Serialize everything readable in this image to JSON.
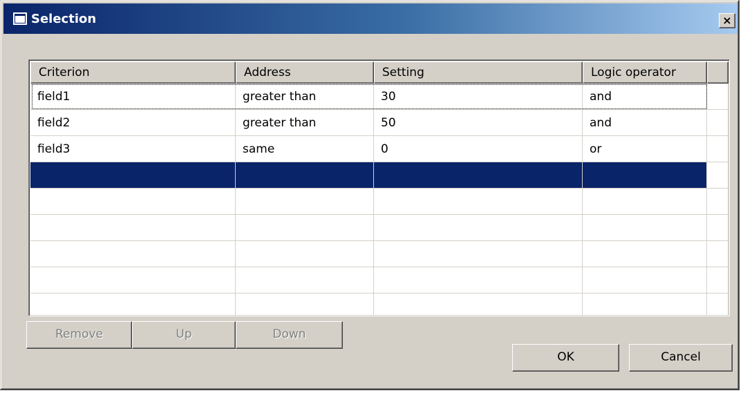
{
  "window": {
    "title": "Selection",
    "close_label": "×"
  },
  "grid": {
    "columns": [
      "Criterion",
      "Address",
      "Setting",
      "Logic operator"
    ],
    "rows": [
      [
        "field1",
        "greater than",
        "30",
        "and"
      ],
      [
        "field2",
        "greater than",
        "50",
        "and"
      ],
      [
        "field3",
        "same",
        "0",
        "or"
      ],
      [
        "",
        "",
        "",
        ""
      ],
      [
        "",
        "",
        "",
        ""
      ],
      [
        "",
        "",
        "",
        ""
      ],
      [
        "",
        "",
        "",
        ""
      ],
      [
        "",
        "",
        "",
        ""
      ],
      [
        "",
        "",
        "",
        ""
      ]
    ]
  },
  "buttons": {
    "remove": "Remove",
    "up": "Up",
    "down": "Down",
    "ok": "OK",
    "cancel": "Cancel"
  },
  "colors": {
    "selection": "#0a246a",
    "face": "#d4d0c8",
    "disabled_text": "#808080"
  }
}
